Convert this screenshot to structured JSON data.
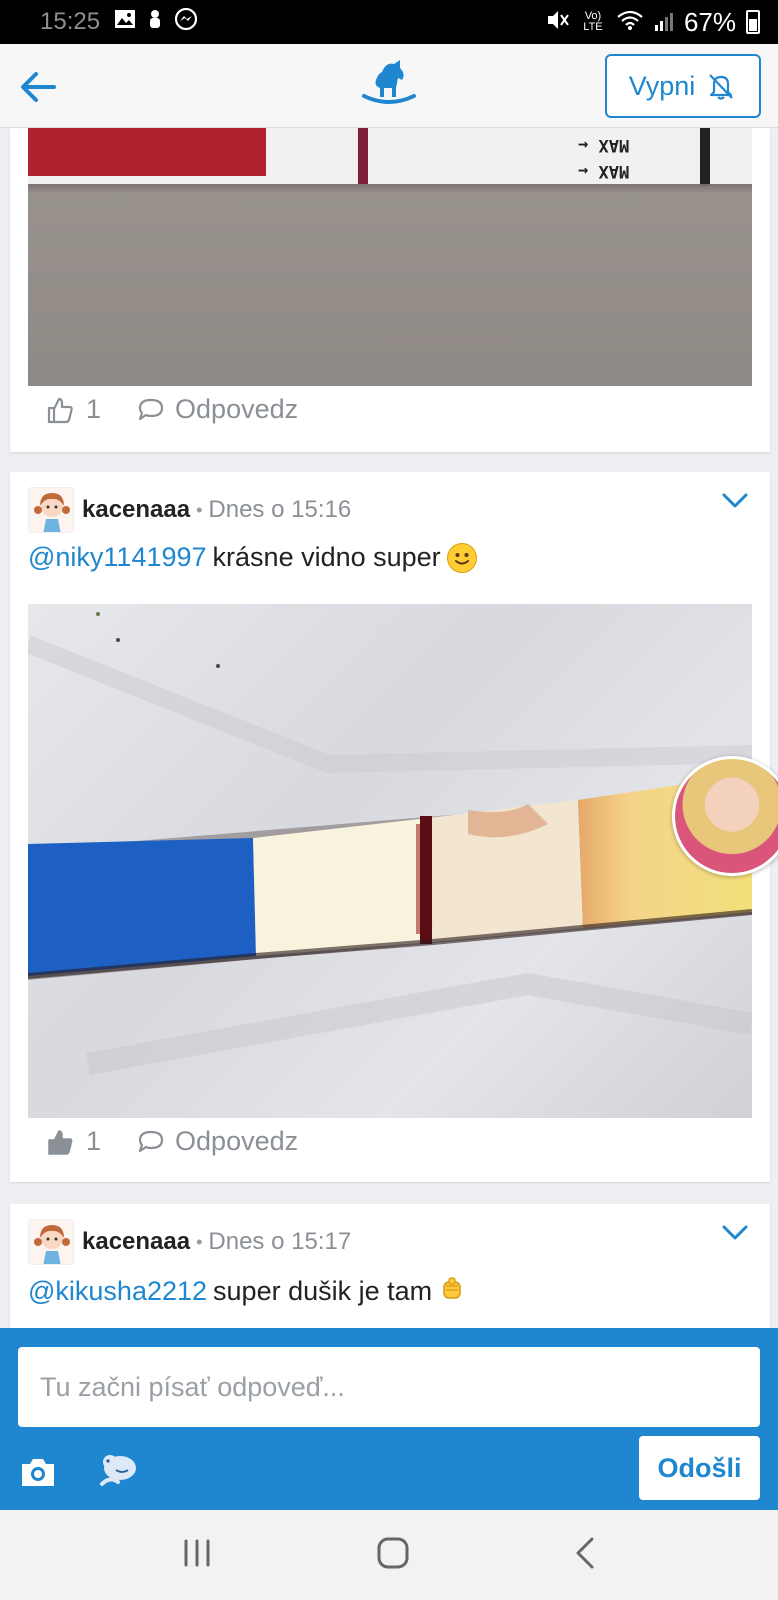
{
  "status_bar": {
    "time": "15:25",
    "network_label": "Vo) LTE",
    "battery": "67%"
  },
  "header": {
    "back_icon": "arrow-left-icon",
    "logo_icon": "rocking-horse-icon",
    "mute_button_label": "Vypni",
    "mute_icon": "bell-off-icon"
  },
  "colors": {
    "accent": "#1f87d0",
    "mention": "#1f87d0",
    "meta_gray": "#8a9096"
  },
  "posts": [
    {
      "likes": "1",
      "reply_label": "Odpovedz",
      "liked": false,
      "photo_text": "MAX"
    },
    {
      "username": "kacenaaa",
      "time": "Dnes o 15:16",
      "mention": "@niky1141997",
      "text": "krásne vidno super",
      "emoji": "slightly-smiling-face",
      "likes": "1",
      "reply_label": "Odpovedz",
      "liked": true
    },
    {
      "username": "kacenaaa",
      "time": "Dnes o 15:17",
      "mention": "@kikusha2212",
      "text": "super dušik je tam",
      "emoji": "raised-fist"
    }
  ],
  "compose": {
    "placeholder": "Tu začni písať odpoveď...",
    "send_label": "Odošli",
    "camera_icon": "camera-icon",
    "sticker_icon": "sticker-icon"
  },
  "nav": {
    "recents_icon": "recents-icon",
    "home_icon": "home-icon",
    "back_icon": "back-chevron-icon"
  }
}
